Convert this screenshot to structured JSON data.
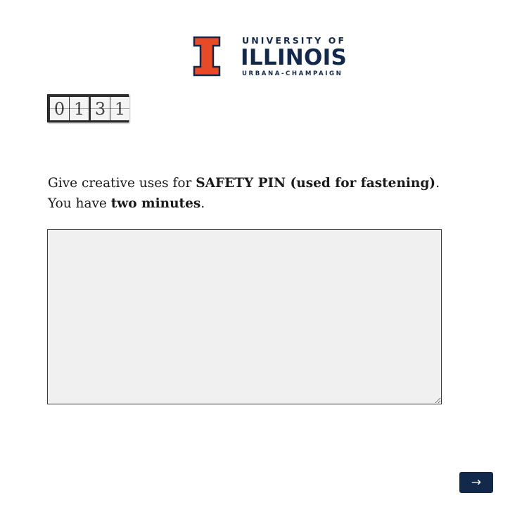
{
  "logo": {
    "line1": "UNIVERSITY OF",
    "line2": "ILLINOIS",
    "line3": "URBANA-CHAMPAIGN",
    "icon": "block-i-logo",
    "colors": {
      "orange": "#e84a27",
      "navy": "#13294b"
    }
  },
  "timer": {
    "minutes": [
      "0",
      "1"
    ],
    "seconds": [
      "3",
      "1"
    ]
  },
  "prompt": {
    "intro": "Give creative uses for ",
    "object": "SAFETY PIN (used for fastening)",
    "after_object": ".",
    "line2_intro": "You have ",
    "duration": "two minutes",
    "after_duration": "."
  },
  "answer": {
    "value": "",
    "background": "#f0f0f0"
  },
  "navigation": {
    "next_label": "→",
    "next_color": "#13294b"
  }
}
